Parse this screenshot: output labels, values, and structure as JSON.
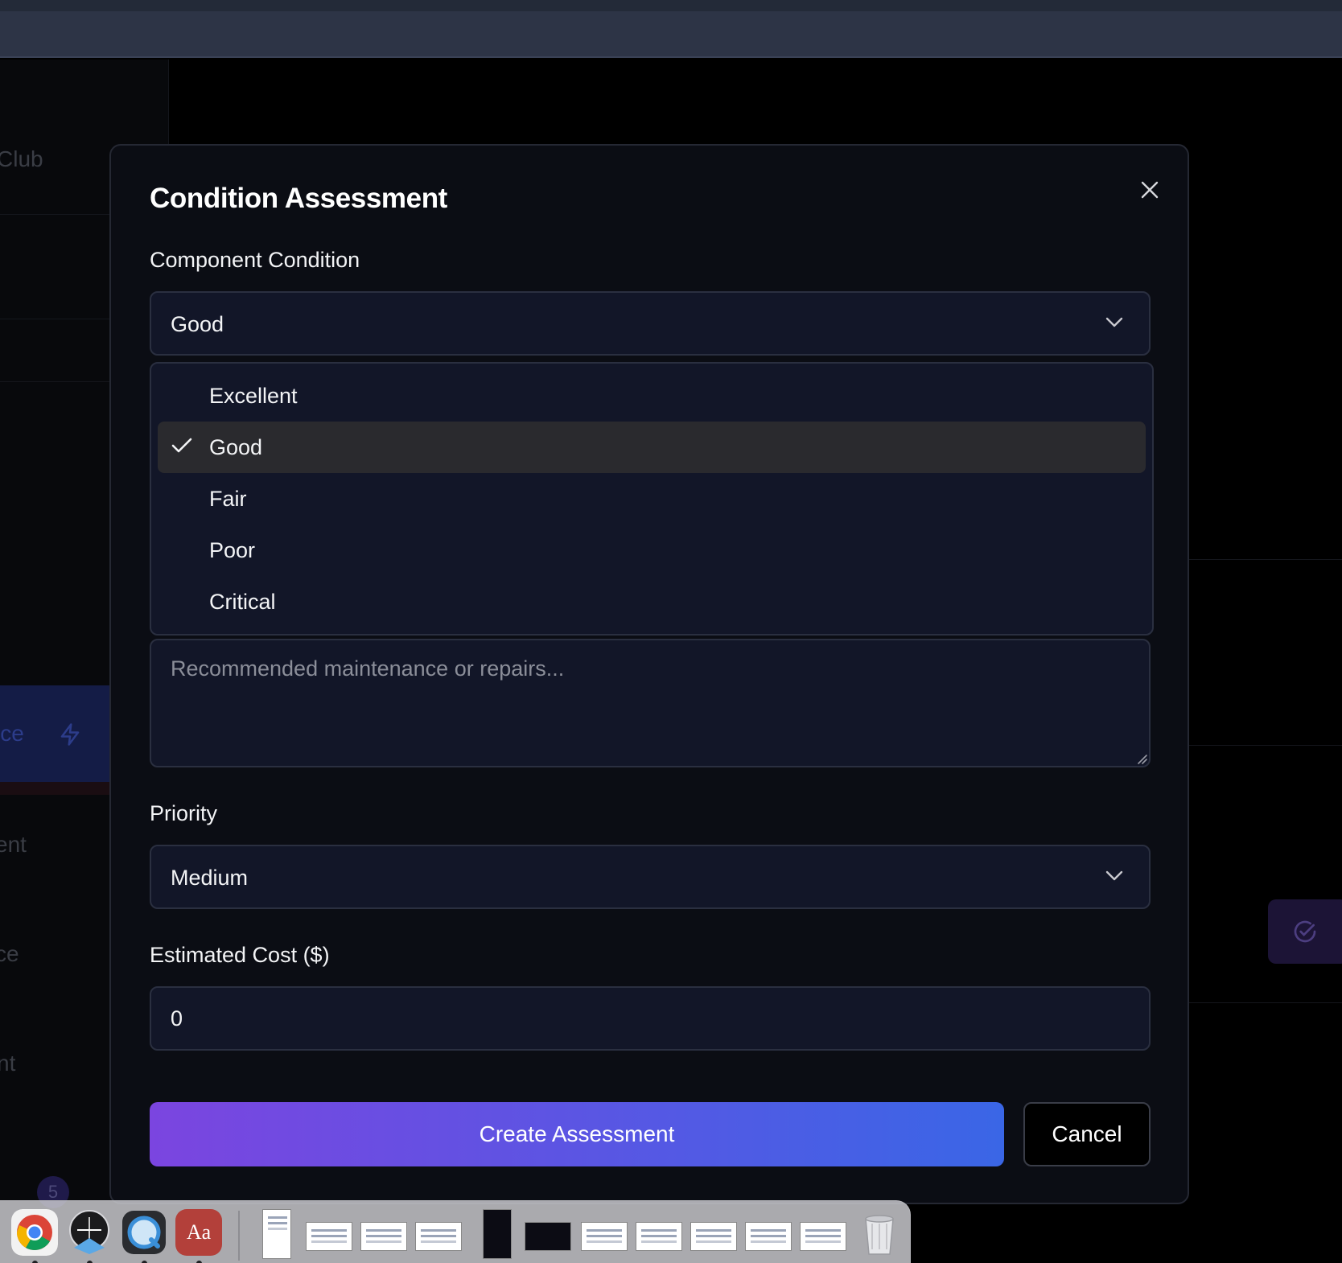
{
  "background": {
    "sidebar_fragments": [
      "Club",
      "ice",
      "ent",
      "ce",
      "nt"
    ],
    "badge": "5"
  },
  "modal": {
    "title": "Condition Assessment",
    "condition": {
      "label": "Component Condition",
      "value": "Good",
      "options": [
        {
          "label": "Excellent",
          "selected": false
        },
        {
          "label": "Good",
          "selected": true
        },
        {
          "label": "Fair",
          "selected": false
        },
        {
          "label": "Poor",
          "selected": false
        },
        {
          "label": "Critical",
          "selected": false
        }
      ]
    },
    "notes": {
      "placeholder": "Recommended maintenance or repairs..."
    },
    "priority": {
      "label": "Priority",
      "value": "Medium"
    },
    "cost": {
      "label": "Estimated Cost ($)",
      "value": "0"
    },
    "actions": {
      "submit": "Create Assessment",
      "cancel": "Cancel"
    }
  },
  "dock": {
    "apps": [
      "chrome-icon",
      "instruments-icon",
      "quicktime-icon",
      "dictionary-icon",
      "trash-icon"
    ],
    "dictionary_label": "Aa"
  },
  "colors": {
    "modal_bg": "#0b0d14",
    "field_bg": "#121628",
    "field_border": "#2a2f40",
    "selected_option_bg": "#2a2a2e",
    "button_gradient_start": "#7b45e0",
    "button_gradient_end": "#3a66e6"
  }
}
